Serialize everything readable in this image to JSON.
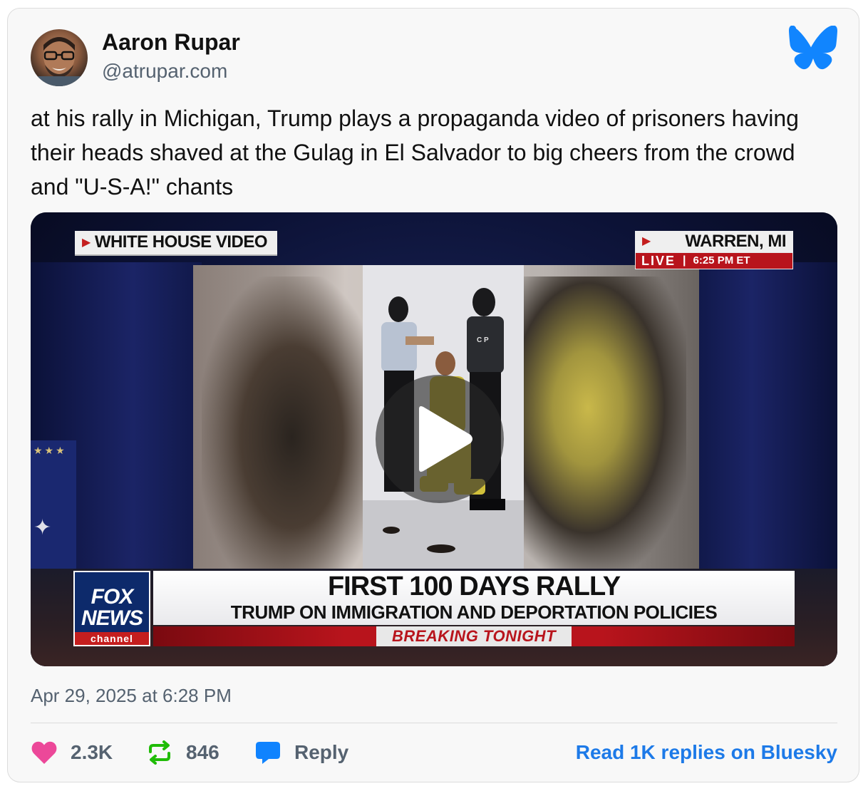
{
  "author": {
    "display_name": "Aaron Rupar",
    "handle": "@atrupar.com"
  },
  "post": {
    "text": "at his rally in Michigan, Trump plays a propaganda video of prisoners having their heads shaved at the Gulag in El Salvador to big cheers from the crowd and \"U-S-A!\" chants",
    "timestamp": "Apr 29, 2025 at 6:28 PM"
  },
  "video": {
    "tag_left": "WHITE HOUSE VIDEO",
    "location": "WARREN, MI",
    "live_label": "LIVE",
    "live_time": "6:25 PM ET",
    "headline": "FIRST 100 DAYS RALLY",
    "subheadline": "TRUMP ON IMMIGRATION AND DEPORTATION POLICIES",
    "banner": "BREAKING TONIGHT",
    "logo_line1": "FOX",
    "logo_line2": "NEWS",
    "logo_line3": "channel",
    "guard_insignia": "C P"
  },
  "actions": {
    "likes": "2.3K",
    "reposts": "846",
    "reply_label": "Reply",
    "read_replies": "Read 1K replies on Bluesky"
  },
  "colors": {
    "like": "#ec4899",
    "repost": "#20bc07",
    "reply": "#1083fe",
    "link": "#1d7ae8",
    "bluesky_logo": "#1185fe"
  },
  "icons": {
    "like": "heart-icon",
    "repost": "repost-icon",
    "reply": "chat-bubble-icon",
    "brand": "bluesky-butterfly-icon",
    "play": "play-icon"
  }
}
